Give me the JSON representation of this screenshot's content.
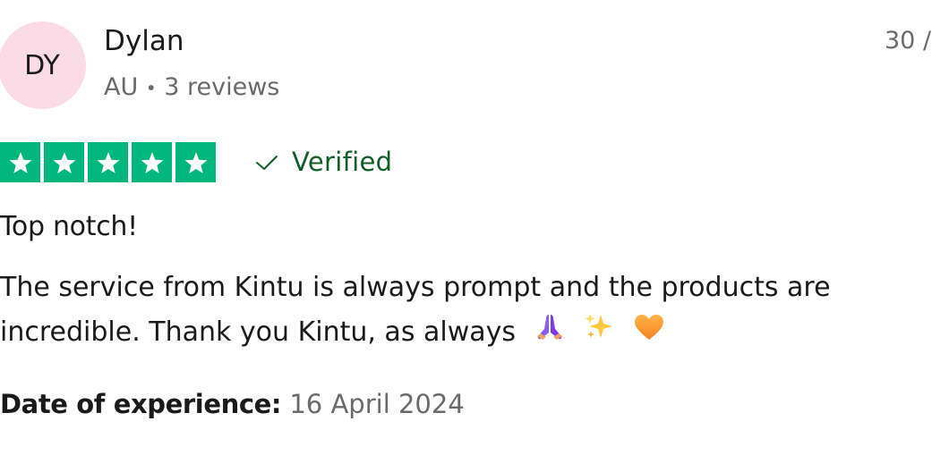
{
  "reviewer": {
    "initials": "DY",
    "name": "Dylan",
    "country": "AU",
    "separator": "•",
    "reviews": "3 reviews"
  },
  "review": {
    "date_partial": "30 /",
    "rating": 5,
    "rating_max": 5,
    "verified_label": "Verified",
    "title": "Top notch!",
    "body": "The service from Kintu is always prompt and the products are incredible. Thank you Kintu, as always",
    "emojis": [
      "folded-hands-icon",
      "sparkles-icon",
      "orange-heart-icon"
    ],
    "experience_label": "Date of experience:",
    "experience_date": "16 April 2024"
  },
  "colors": {
    "star_green": "#00b67a",
    "verified_green": "#105d28",
    "avatar_pink": "#fbdbe5",
    "muted_text": "#696a6a"
  }
}
